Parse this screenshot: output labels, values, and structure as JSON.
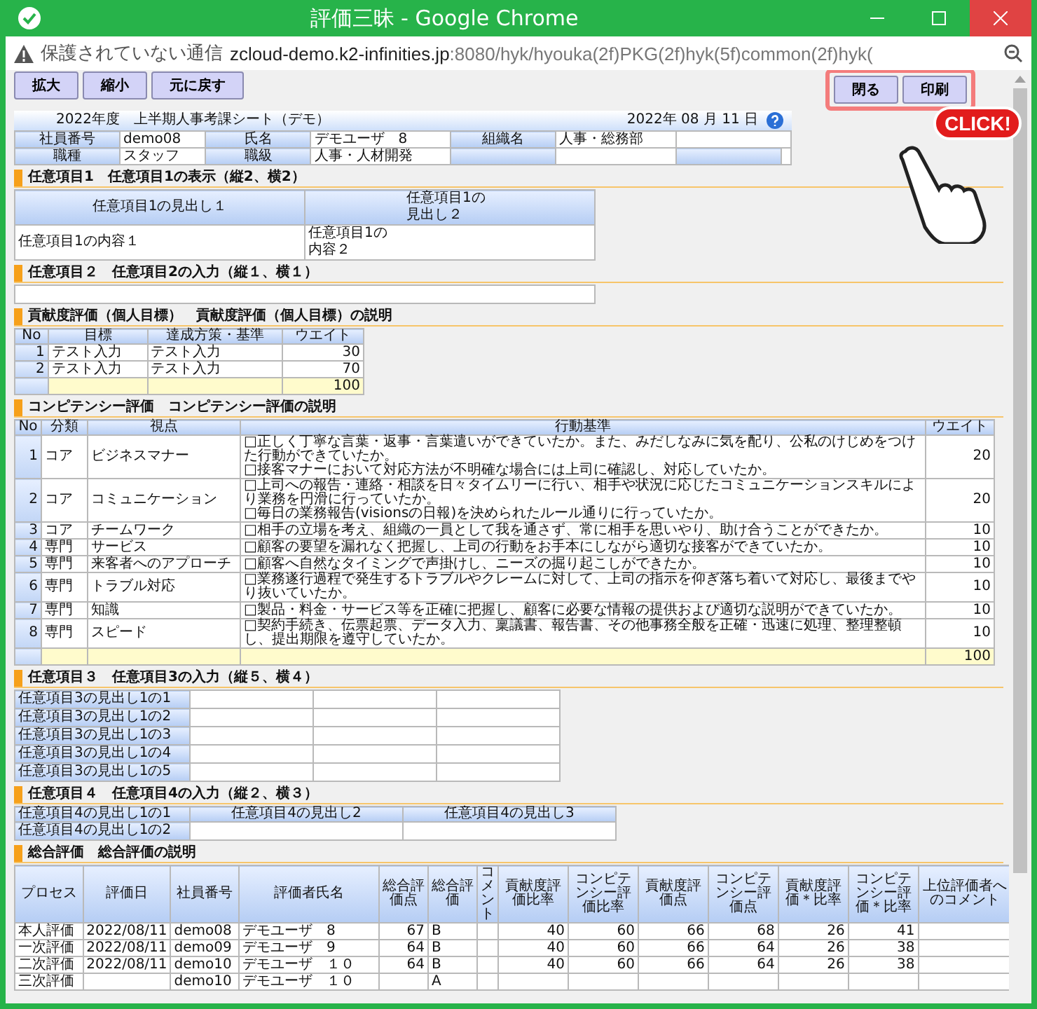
{
  "window": {
    "title": "評価三昧 - Google Chrome"
  },
  "address_bar": {
    "security": "保護されていない通信",
    "url_host": "zcloud-demo.k2-infinities.jp",
    "url_path": ":8080/hyk/hyouka(2f)PKG(2f)hyk(5f)common(2f)hyk("
  },
  "toolbar": {
    "left_buttons": [
      "拡大",
      "縮小",
      "元に戻す"
    ],
    "right_buttons": [
      "閉る",
      "印刷"
    ]
  },
  "callout": "CLICK!",
  "sheet": {
    "title": "2022年度　上半期人事考課シート（デモ）",
    "date": "2022年 08 月 11 日",
    "info": [
      [
        {
          "label": "社員番号",
          "value": "demo08"
        },
        {
          "label": "氏名",
          "value": "デモユーザ　8"
        },
        {
          "label": "組織名",
          "value": "人事・総務部"
        }
      ],
      [
        {
          "label": "職種",
          "value": "スタッフ"
        },
        {
          "label": "職級",
          "value": "人事・人材開発"
        }
      ]
    ]
  },
  "sections": [
    {
      "kind": "display",
      "title": "任意項目1　任意項目1の表示（縦2、横2）",
      "headers": [
        "任意項目1の見出し１",
        "任意項目1の見出し２"
      ],
      "cells": [
        "任意項目1の内容１",
        "任意項目1の内容２"
      ]
    },
    {
      "kind": "input",
      "title": "任意項目２　任意項目2の入力（縦１、横１）"
    },
    {
      "kind": "goals",
      "title": "貢献度評価（個人目標）　貢献度評価（個人目標）の説明",
      "columns": [
        "No",
        "目標",
        "達成方策・基準",
        "ウエイト"
      ],
      "rows": [
        [
          "1",
          "テスト入力",
          "テスト入力",
          "30"
        ],
        [
          "2",
          "テスト入力",
          "テスト入力",
          "70"
        ]
      ],
      "total": "100"
    },
    {
      "kind": "competency",
      "title": "コンピテンシー評価　コンピテンシー評価の説明",
      "columns": [
        "No",
        "分類",
        "視点",
        "行動基準",
        "ウエイト"
      ],
      "rows": [
        [
          "1",
          "コア",
          "ビジネスマナー",
          "□正しく丁寧な言葉・返事・言葉遣いができていたか。また、みだしなみに気を配り、公私のけじめをつけた行動ができていたか。\n□接客マナーにおいて対応方法が不明確な場合には上司に確認し、対応していたか。",
          "20"
        ],
        [
          "2",
          "コア",
          "コミュニケーション",
          "□上司への報告・連絡・相談を日々タイムリーに行い、相手や状況に応じたコミュニケーションスキルにより業務を円滑に行っていたか。\n□毎日の業務報告(visionsの日報)を決められたルール通りに行っていたか。",
          "20"
        ],
        [
          "3",
          "コア",
          "チームワーク",
          "□相手の立場を考え、組織の一員として我を通さず、常に相手を思いやり、助け合うことができたか。",
          "10"
        ],
        [
          "4",
          "専門",
          "サービス",
          "□顧客の要望を漏れなく把握し、上司の行動をお手本にしながら適切な接客ができていたか。",
          "10"
        ],
        [
          "5",
          "専門",
          "来客者へのアプローチ",
          "□顧客へ自然なタイミングで声掛けし、ニーズの掘り起こしができたか。",
          "10"
        ],
        [
          "6",
          "専門",
          "トラブル対応",
          "□業務遂行過程で発生するトラブルやクレームに対して、上司の指示を仰ぎ落ち着いて対応し、最後までやり抜いていたか。",
          "10"
        ],
        [
          "7",
          "専門",
          "知識",
          "□製品・料金・サービス等を正確に把握し、顧客に必要な情報の提供および適切な説明ができていたか。",
          "10"
        ],
        [
          "8",
          "専門",
          "スピード",
          "□契約手続き、伝票起票、データ入力、稟議書、報告書、その他事務全般を正確・迅速に処理、整理整頓し、提出期限を遵守していたか。",
          "10"
        ]
      ],
      "total": "100"
    },
    {
      "kind": "grid",
      "title": "任意項目３　任意項目3の入力（縦５、横４）",
      "row_headers": [
        "任意項目3の見出し1の1",
        "任意項目3の見出し1の2",
        "任意項目3の見出し1の3",
        "任意項目3の見出し1の4",
        "任意項目3の見出し1の5"
      ]
    },
    {
      "kind": "grid_headed",
      "title": "任意項目４　任意項目4の入力（縦２、横３）",
      "row_headers": [
        "任意項目4の見出し1の1",
        "任意項目4の見出し1の2"
      ],
      "col_headers": [
        "任意項目4の見出し2",
        "任意項目4の見出し3"
      ]
    },
    {
      "kind": "summary",
      "title": "総合評価　総合評価の説明",
      "columns": [
        "プロセス",
        "評価日",
        "社員番号",
        "評価者氏名",
        "総合評価点",
        "総合評価",
        "コメント",
        "貢献度評価比率",
        "コンピテンシー評価比率",
        "貢献度評価点",
        "コンピテンシー評価点",
        "貢献度評価＊比率",
        "コンピテンシー評価＊比率",
        "上位評価者へのコメント"
      ],
      "rows": [
        [
          "本人評価",
          "2022/08/11",
          "demo08",
          "デモユーザ　8",
          "67",
          "B",
          "",
          "40",
          "60",
          "66",
          "68",
          "26",
          "41",
          ""
        ],
        [
          "一次評価",
          "2022/08/11",
          "demo09",
          "デモユーザ　9",
          "64",
          "B",
          "",
          "40",
          "60",
          "66",
          "64",
          "26",
          "38",
          ""
        ],
        [
          "二次評価",
          "2022/08/11",
          "demo10",
          "デモユーザ　１０",
          "64",
          "B",
          "",
          "40",
          "60",
          "66",
          "64",
          "26",
          "38",
          ""
        ],
        [
          "三次評価",
          "",
          "demo10",
          "デモユーザ　１０",
          "",
          "A",
          "",
          "",
          "",
          "",
          "",
          "",
          "",
          ""
        ]
      ]
    }
  ]
}
